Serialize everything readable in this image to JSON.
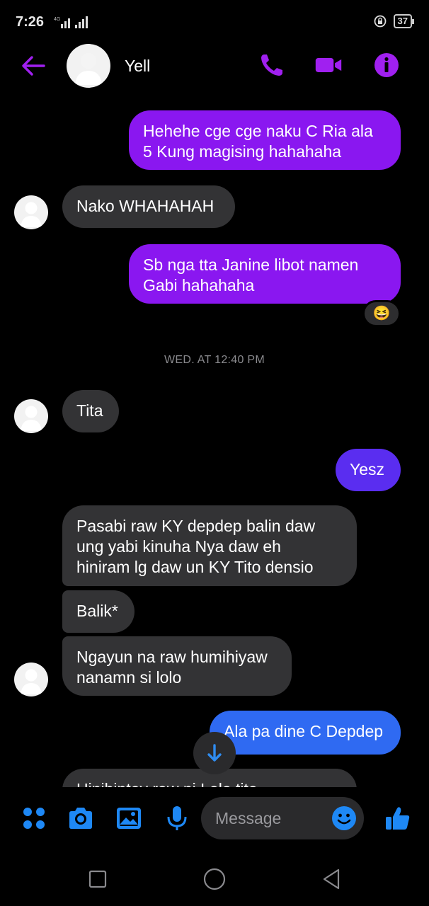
{
  "status_bar": {
    "time": "7:26",
    "network": "4G",
    "battery": "37"
  },
  "header": {
    "contact_name": "Yell",
    "icons": [
      "back-arrow-icon",
      "avatar",
      "phone-icon",
      "video-camera-icon",
      "info-icon"
    ]
  },
  "thread": {
    "messages": [
      {
        "from": "me",
        "text": "Hehehe cge cge naku C Ria ala 5 Kung magising hahahaha",
        "lines": [
          "Hehehe cge cge naku C Ria ala",
          "5 Kung magising hahahaha"
        ]
      },
      {
        "from": "them",
        "text": "Nako WHAHAHAH"
      },
      {
        "from": "me",
        "text": "Sb nga tta Janine libot namen Gabi hahahaha",
        "lines": [
          "Sb nga tta Janine libot namen",
          "Gabi hahahaha"
        ],
        "reaction": "😆"
      },
      {
        "from": "them",
        "text": "Tita"
      },
      {
        "from": "me",
        "text": "Yesz"
      },
      {
        "from": "them",
        "lines": [
          "Pasabi raw KY depdep balin daw",
          "ung yabi kinuha Nya daw eh",
          "hiniram lg daw un KY Tito densio"
        ]
      },
      {
        "from": "them",
        "text": "Balik*"
      },
      {
        "from": "them",
        "lines": [
          "Ngayun na raw humihiyaw",
          "nanamn si lolo"
        ]
      },
      {
        "from": "me",
        "text": "Ala pa dine C Depdep"
      },
      {
        "from": "them",
        "text": "Hinihintay raw ni Lolo tito"
      }
    ],
    "timestamp": "WED. AT 12:40 PM"
  },
  "composer": {
    "placeholder": "Message",
    "icons": [
      "apps-grid-icon",
      "camera-icon",
      "gallery-icon",
      "microphone-icon",
      "emoji-icon",
      "thumbs-up-icon"
    ]
  },
  "colors": {
    "accent_purple": "#a020f0",
    "accent_blue": "#1877f2",
    "bubble_incoming": "#333335",
    "bubble_purple": "#8a17f0",
    "bubble_violet": "#5a2df0",
    "bubble_blue": "#2f6af2"
  }
}
